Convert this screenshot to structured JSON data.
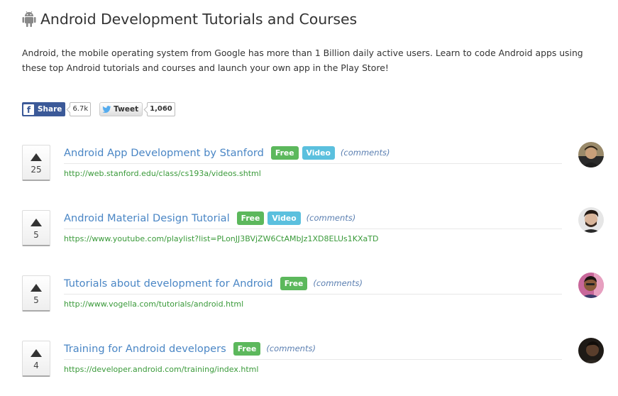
{
  "header": {
    "icon": "android-icon",
    "title": "Android Development Tutorials and Courses"
  },
  "intro": {
    "text": "Android, the mobile operating system from Google has more than 1 Billion daily active users. Learn to code Android apps using these top Android tutorials and courses and launch your own app in the Play Store!"
  },
  "social": {
    "share_label": "Share",
    "share_count": "6.7k",
    "tweet_label": "Tweet",
    "tweet_count": "1,060"
  },
  "colors": {
    "title_link": "#4a86c5",
    "url_green": "#3a9a3a",
    "badge_free": "#5cb85c",
    "badge_video": "#5bc0de",
    "facebook": "#3b5998"
  },
  "items": [
    {
      "votes": "25",
      "title": "Android App Development by Stanford",
      "badges": [
        "Free",
        "Video"
      ],
      "comments": "(comments)",
      "url": "http://web.stanford.edu/class/cs193a/videos.shtml"
    },
    {
      "votes": "5",
      "title": "Android Material Design Tutorial",
      "badges": [
        "Free",
        "Video"
      ],
      "comments": "(comments)",
      "url": "https://www.youtube.com/playlist?list=PLonJJ3BVjZW6CtAMbJz1XD8ELUs1KXaTD"
    },
    {
      "votes": "5",
      "title": "Tutorials about development for Android",
      "badges": [
        "Free"
      ],
      "comments": "(comments)",
      "url": "http://www.vogella.com/tutorials/android.html"
    },
    {
      "votes": "4",
      "title": "Training for Android developers",
      "badges": [
        "Free"
      ],
      "comments": "(comments)",
      "url": "https://developer.android.com/training/index.html"
    }
  ]
}
